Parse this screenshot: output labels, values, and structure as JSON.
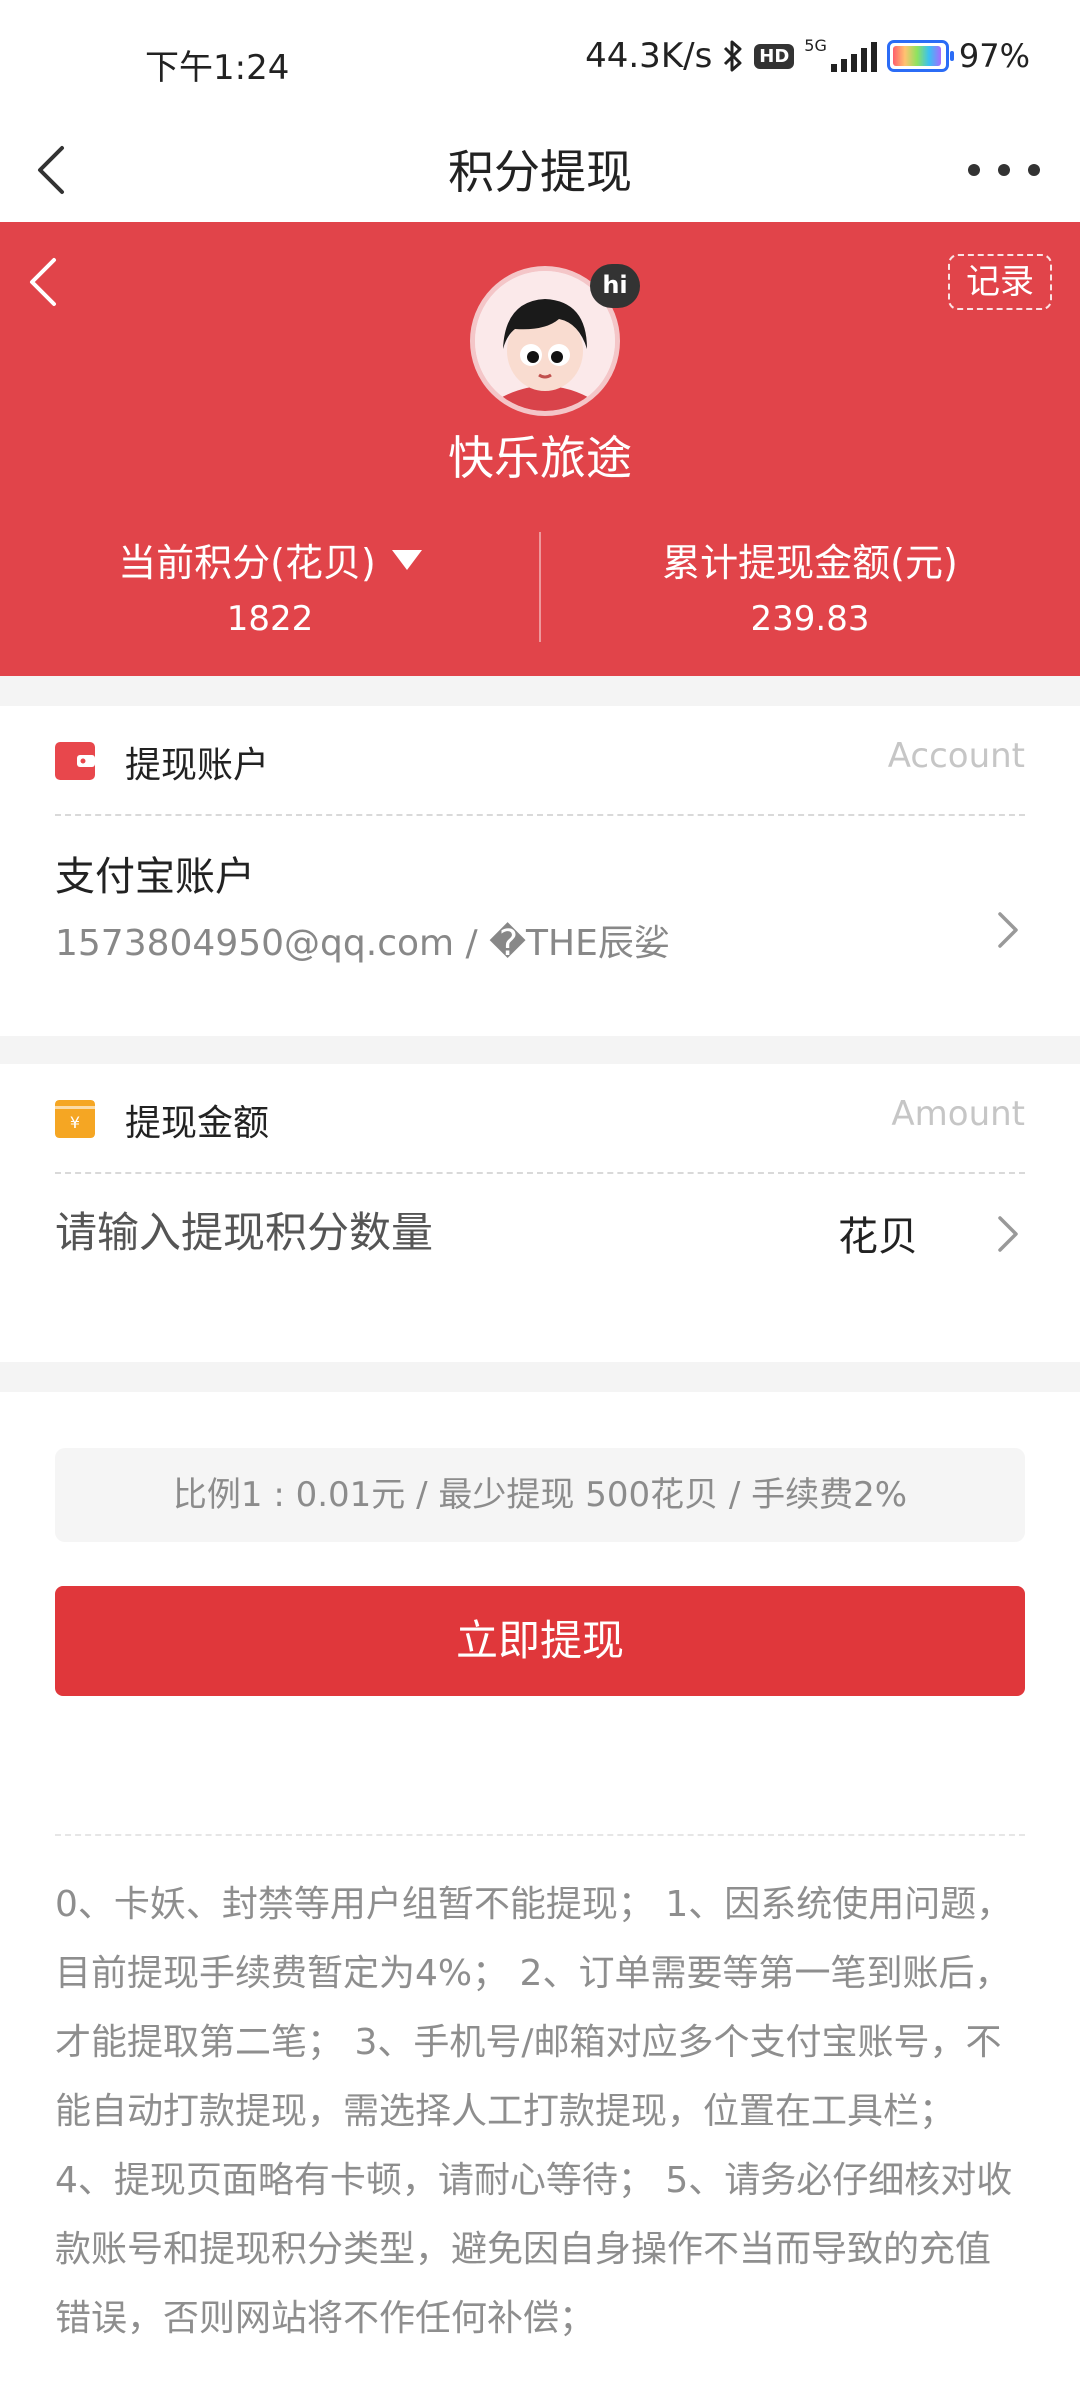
{
  "status_bar": {
    "time": "下午1:24",
    "net_speed": "44.3K/s",
    "hd": "HD",
    "network": "5G",
    "battery": "97%"
  },
  "nav": {
    "title": "积分提现"
  },
  "profile": {
    "hi_badge": "hi",
    "record_label": "记录",
    "username": "快乐旅途",
    "points_label": "当前积分(花贝)",
    "points_value": "1822",
    "total_label": "累计提现金额(元)",
    "total_value": "239.83"
  },
  "account_section": {
    "title": "提现账户",
    "title_en": "Account",
    "account_name": "支付宝账户",
    "account_detail": "1573804950@qq.com / �THE辰娑"
  },
  "amount_section": {
    "title": "提现金额",
    "title_en": "Amount",
    "input_placeholder": "请输入提现积分数量",
    "input_value": "",
    "unit": "花贝"
  },
  "rate_info": "比例1 : 0.01元 / 最少提现 500花贝 / 手续费2%",
  "submit_label": "立即提现",
  "notice": "0、卡妖、封禁等用户组暂不能提现； 1、因系统使用问题，目前提现手续费暂定为4%； 2、订单需要等第一笔到账后，才能提取第二笔； 3、手机号/邮箱对应多个支付宝账号，不能自动打款提现，需选择人工打款提现，位置在工具栏； 4、提现页面略有卡顿，请耐心等待； 5、请务必仔细核对收款账号和提现积分类型，避免因自身操作不当而导致的充值错误，否则网站将不作任何补偿；",
  "colors": {
    "header_red": "#e1444a",
    "button_red": "#e0373b",
    "wallet_icon": "#e8474c",
    "amount_icon": "#f5a623"
  },
  "icons": [
    "back-arrow-icon",
    "more-dots-icon",
    "bluetooth-icon",
    "signal-icon",
    "battery-icon",
    "wallet-icon",
    "yen-icon",
    "chevron-right-icon",
    "caret-down-icon"
  ]
}
